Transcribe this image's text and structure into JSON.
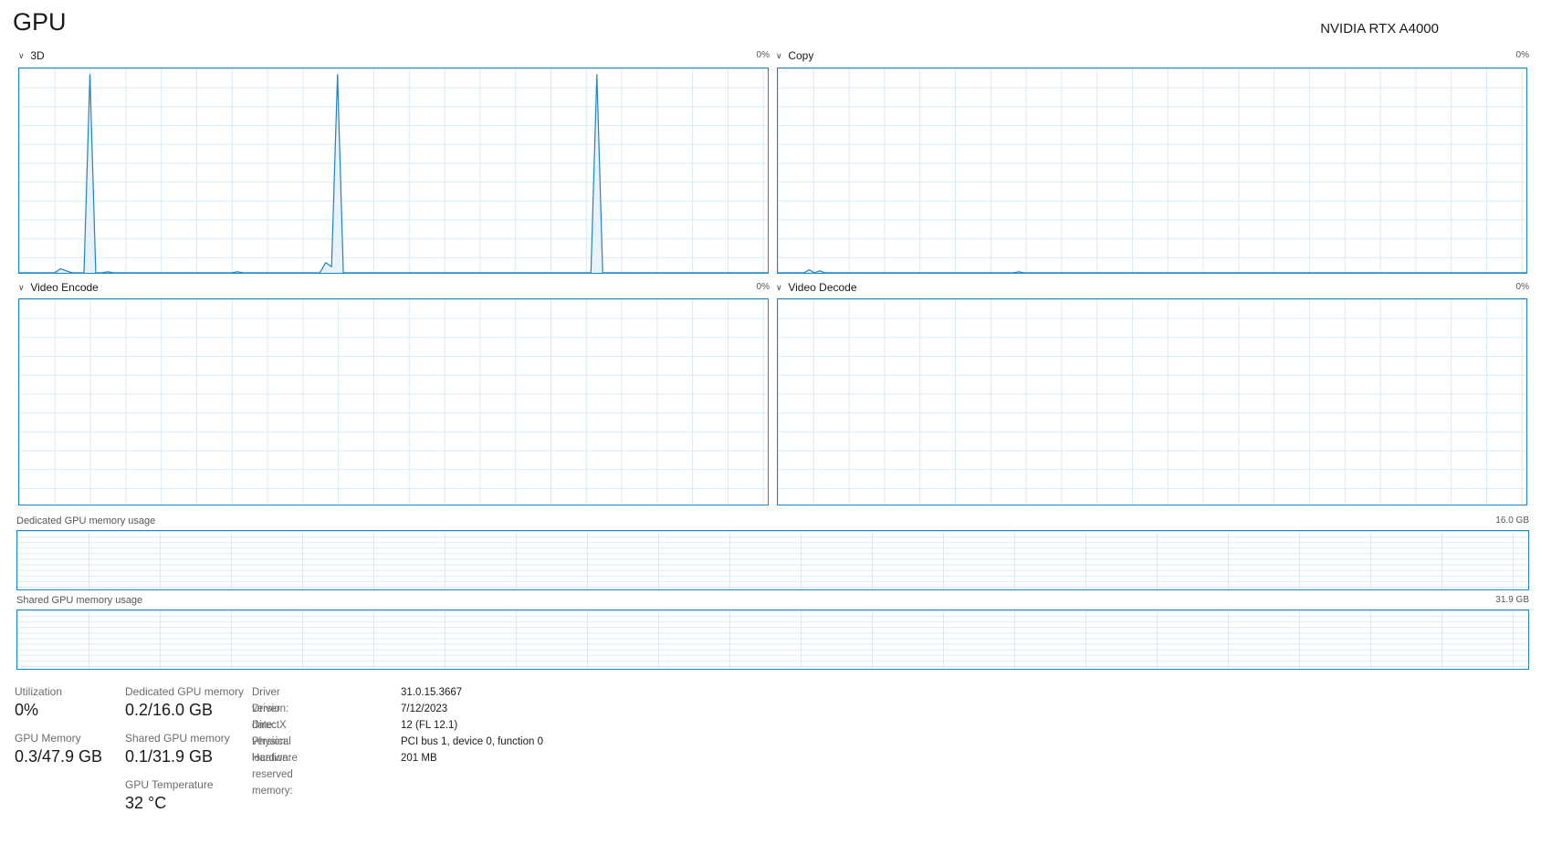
{
  "header": {
    "title": "GPU",
    "device_name": "NVIDIA RTX A4000"
  },
  "engines": [
    {
      "name": "3D",
      "percent": "0%",
      "samples": [
        0,
        0,
        0,
        0,
        0,
        0,
        0,
        2,
        1,
        0,
        0,
        0,
        98,
        0,
        0,
        0.5,
        0,
        0,
        0,
        0,
        0,
        0,
        0,
        0,
        0,
        0,
        0,
        0,
        0,
        0,
        0,
        0,
        0,
        0,
        0,
        0,
        0,
        0.5,
        0,
        0,
        0,
        0,
        0,
        0,
        0,
        0,
        0,
        0,
        0,
        0,
        0,
        0,
        5,
        3,
        98,
        0,
        0,
        0,
        0,
        0,
        0,
        0,
        0,
        0,
        0,
        0,
        0,
        0,
        0,
        0,
        0,
        0,
        0,
        0,
        0,
        0,
        0,
        0,
        0,
        0,
        0,
        0,
        0,
        0,
        0,
        0,
        0,
        0,
        0,
        0,
        0,
        0,
        0,
        0,
        0,
        0,
        0,
        0,
        98,
        0,
        0,
        0,
        0,
        0,
        0,
        0,
        0,
        0,
        0,
        0,
        0,
        0,
        0,
        0,
        0,
        0,
        0,
        0,
        0,
        0,
        0,
        0,
        0,
        0,
        0,
        0,
        0,
        0
      ]
    },
    {
      "name": "Copy",
      "percent": "0%",
      "samples": [
        0,
        0,
        0,
        0,
        0,
        0,
        1.5,
        0,
        1,
        0,
        0,
        0,
        0,
        0,
        0,
        0,
        0,
        0,
        0,
        0,
        0,
        0,
        0,
        0,
        0,
        0,
        0,
        0,
        0,
        0,
        0,
        0,
        0,
        0,
        0,
        0,
        0,
        0,
        0,
        0,
        0,
        0,
        0,
        0,
        0,
        0,
        0.5,
        0,
        0,
        0,
        0,
        0,
        0,
        0,
        0,
        0,
        0,
        0,
        0,
        0,
        0,
        0,
        0,
        0,
        0,
        0,
        0,
        0,
        0,
        0,
        0,
        0,
        0,
        0,
        0,
        0,
        0,
        0,
        0,
        0,
        0,
        0,
        0,
        0,
        0,
        0,
        0,
        0,
        0,
        0,
        0,
        0,
        0,
        0,
        0,
        0,
        0,
        0,
        0,
        0,
        0,
        0,
        0,
        0,
        0,
        0,
        0,
        0,
        0,
        0,
        0,
        0,
        0,
        0,
        0,
        0,
        0,
        0,
        0,
        0,
        0,
        0,
        0,
        0,
        0,
        0,
        0,
        0,
        0,
        0,
        0,
        0,
        0,
        0,
        0,
        0,
        0,
        0,
        0,
        0,
        0,
        0,
        0,
        0
      ]
    },
    {
      "name": "Video Encode",
      "percent": "0%",
      "samples": []
    },
    {
      "name": "Video Decode",
      "percent": "0%",
      "samples": []
    }
  ],
  "memory_graphs": [
    {
      "label": "Dedicated GPU memory usage",
      "max": "16.0 GB"
    },
    {
      "label": "Shared GPU memory usage",
      "max": "31.9 GB"
    }
  ],
  "stats": {
    "utilization": {
      "label": "Utilization",
      "value": "0%"
    },
    "gpu_memory": {
      "label": "GPU Memory",
      "value": "0.3/47.9 GB"
    },
    "dedicated_memory": {
      "label": "Dedicated GPU memory",
      "value": "0.2/16.0 GB"
    },
    "shared_memory": {
      "label": "Shared GPU memory",
      "value": "0.1/31.9 GB"
    },
    "temperature": {
      "label": "GPU Temperature",
      "value": "32 °C"
    }
  },
  "info": [
    {
      "key": "Driver version:",
      "value": "31.0.15.3667"
    },
    {
      "key": "Driver date:",
      "value": "7/12/2023"
    },
    {
      "key": "DirectX version:",
      "value": "12 (FL 12.1)"
    },
    {
      "key": "Physical location:",
      "value": "PCI bus 1, device 0, function 0"
    },
    {
      "key": "Hardware reserved memory:",
      "value": "201 MB"
    }
  ],
  "colors": {
    "line": "#1f84c4",
    "fill": "#e8f2fa",
    "grid": "#d9eaf5"
  }
}
